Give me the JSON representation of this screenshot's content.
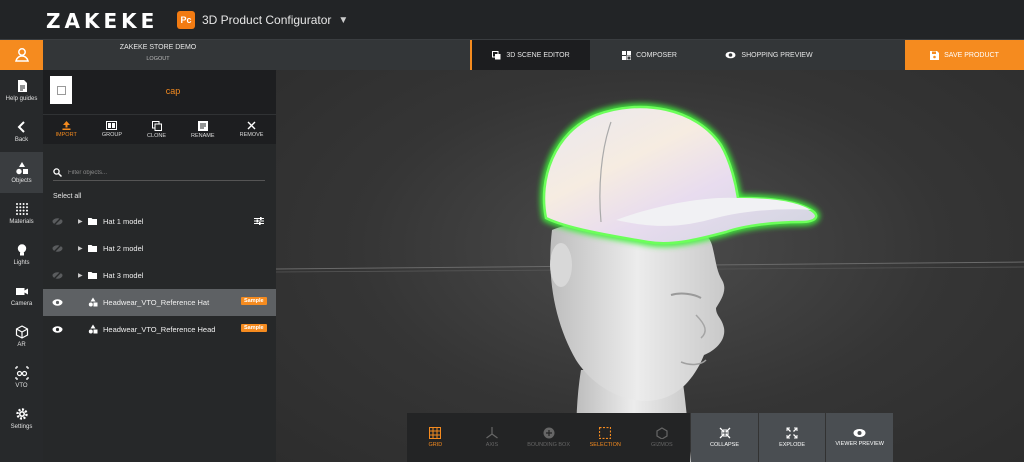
{
  "header": {
    "logo": "ZAKEKE",
    "app_badge": "Pc",
    "app_name": "3D Product Configurator"
  },
  "rail": {
    "items": [
      {
        "label": "Help guides",
        "icon": "document-icon"
      },
      {
        "label": "Back",
        "icon": "chevron-left-icon"
      },
      {
        "label": "Objects",
        "icon": "shapes-icon"
      },
      {
        "label": "Materials",
        "icon": "grid-dots-icon"
      },
      {
        "label": "Lights",
        "icon": "bulb-icon"
      },
      {
        "label": "Camera",
        "icon": "camera-icon"
      },
      {
        "label": "AR",
        "icon": "cube-icon"
      },
      {
        "label": "VTO",
        "icon": "glasses-icon"
      },
      {
        "label": "Settings",
        "icon": "gear-icon"
      }
    ]
  },
  "store": {
    "name": "ZAKEKE STORE DEMO",
    "logout": "LOGOUT"
  },
  "tabs": [
    {
      "label": "3D SCENE EDITOR",
      "icon": "copy-icon",
      "active": true
    },
    {
      "label": "COMPOSER",
      "icon": "composer-icon",
      "active": false
    },
    {
      "label": "SHOPPING PREVIEW",
      "icon": "eye-icon",
      "active": false
    }
  ],
  "save_label": "SAVE PRODUCT",
  "panel": {
    "title": "cap",
    "tools": [
      {
        "label": "IMPORT",
        "icon": "import-icon"
      },
      {
        "label": "GROUP",
        "icon": "group-icon"
      },
      {
        "label": "CLONE",
        "icon": "clone-icon"
      },
      {
        "label": "RENAME",
        "icon": "rename-icon"
      },
      {
        "label": "REMOVE",
        "icon": "close-icon"
      }
    ],
    "filter_placeholder": "Filter objects...",
    "select_all": "Select all",
    "objects": [
      {
        "label": "Hat 1 model",
        "type": "folder",
        "visible": false
      },
      {
        "label": "Hat 2 model",
        "type": "folder",
        "visible": false
      },
      {
        "label": "Hat 3 model",
        "type": "folder",
        "visible": false
      },
      {
        "label": "Headwear_VTO_Reference Hat",
        "type": "mesh",
        "visible": true,
        "badge": "Sample",
        "selected": true
      },
      {
        "label": "Headwear_VTO_Reference Head",
        "type": "mesh",
        "visible": true,
        "badge": "Sample"
      }
    ]
  },
  "bottom_toolbar": [
    {
      "label": "GRID",
      "icon": "grid-icon",
      "active": true
    },
    {
      "label": "AXIS",
      "icon": "axis-icon",
      "active": false
    },
    {
      "label": "BOUNDING BOX",
      "icon": "bounding-box-icon",
      "active": false
    },
    {
      "label": "SELECTION",
      "icon": "selection-icon",
      "active": true
    },
    {
      "label": "GIZMOS",
      "icon": "gizmos-icon",
      "active": false
    },
    {
      "label": "COLLAPSE",
      "icon": "collapse-icon"
    },
    {
      "label": "EXPLODE",
      "icon": "explode-icon"
    },
    {
      "label": "VIEWER PREVIEW",
      "icon": "eye-icon"
    }
  ],
  "colors": {
    "accent": "#f58b1f",
    "selection_glow": "#3ff23a"
  }
}
